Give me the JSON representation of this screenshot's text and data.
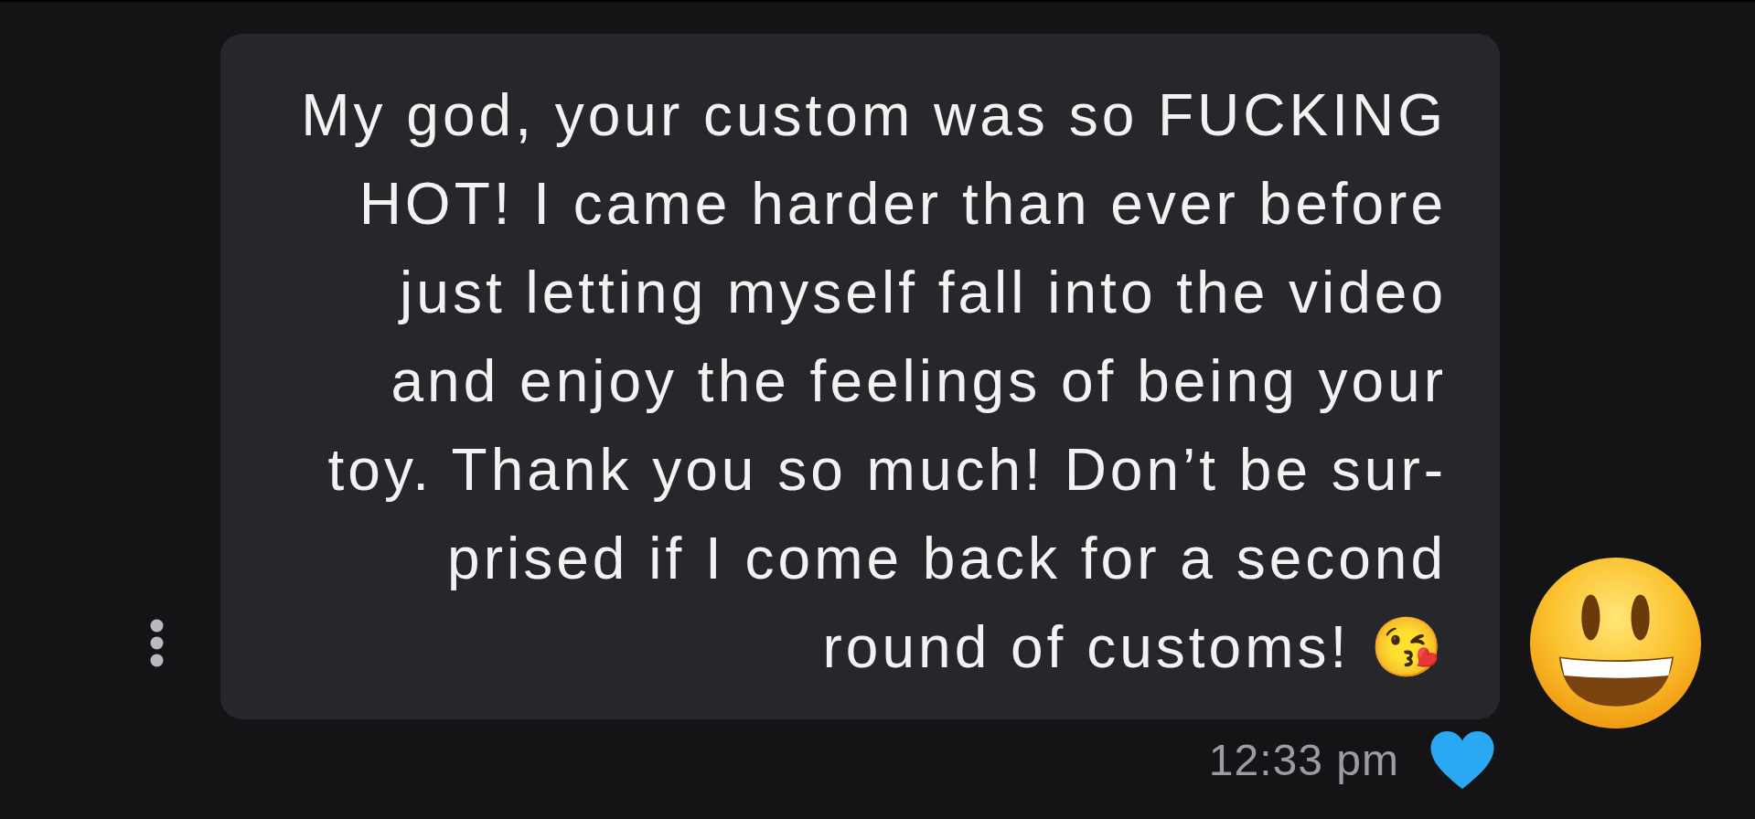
{
  "message": {
    "lines": [
      "My god, your custom was so FUCKING",
      "HOT! I came harder than ever before",
      "just letting myself fall into the video",
      "and enjoy the feelings of being your",
      "toy. Thank you so much! Don’t be sur-",
      "prised if I come back for a second",
      "round of customs! 😘"
    ]
  },
  "hearted": true,
  "timestamp": "12:33 pm"
}
